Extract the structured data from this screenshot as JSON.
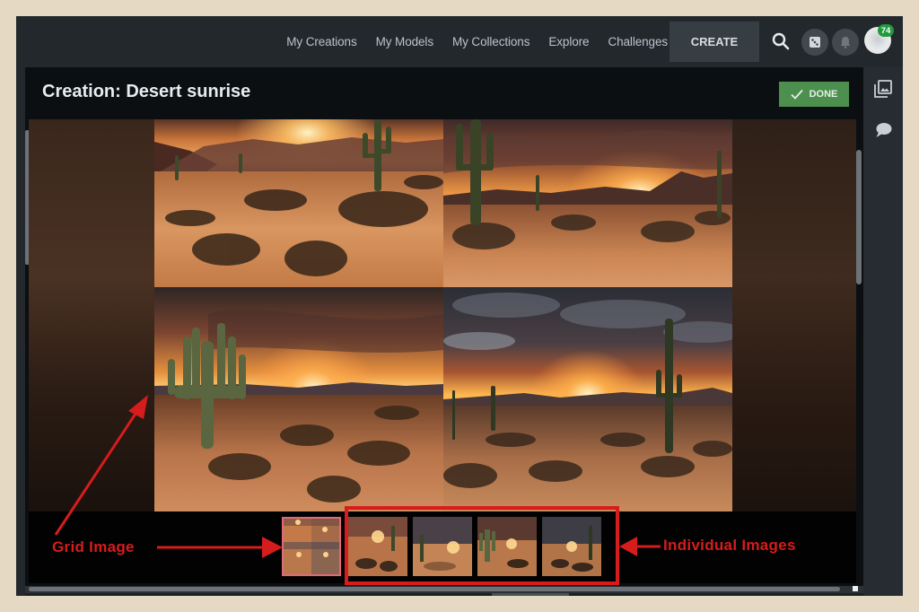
{
  "nav": {
    "links": [
      "My Creations",
      "My Models",
      "My Collections",
      "Explore",
      "Challenges"
    ],
    "create_label": "CREATE",
    "notification_count": "74",
    "icons": [
      "search-icon",
      "dice-icon",
      "bell-icon",
      "avatar"
    ]
  },
  "sidebar_right": {
    "icons": [
      "image-gallery-icon",
      "comment-icon"
    ]
  },
  "modal": {
    "title": "Creation: Desert sunrise",
    "done_label": "DONE"
  },
  "viewer": {
    "grid_tiles": [
      "Desert sunrise with saguaro cactus and grass tufts in sand",
      "Tall cactus silhouette at sunset over desert mountains",
      "Large multi-armed cactus with sunset and clouds",
      "Dramatic clouds over desert with lone saguaro at sunrise"
    ]
  },
  "thumbnails": {
    "grid_thumb": "grid-image",
    "individual_count": 4
  },
  "annotations": {
    "grid_label": "Grid Image",
    "individual_label": "Individual Images",
    "color": "#d61c1c"
  },
  "colors": {
    "accent_green": "#4c8f4f",
    "badge_green": "#1f9a3c",
    "nav_bg": "#23282d",
    "modal_bg": "#0c0f12"
  }
}
